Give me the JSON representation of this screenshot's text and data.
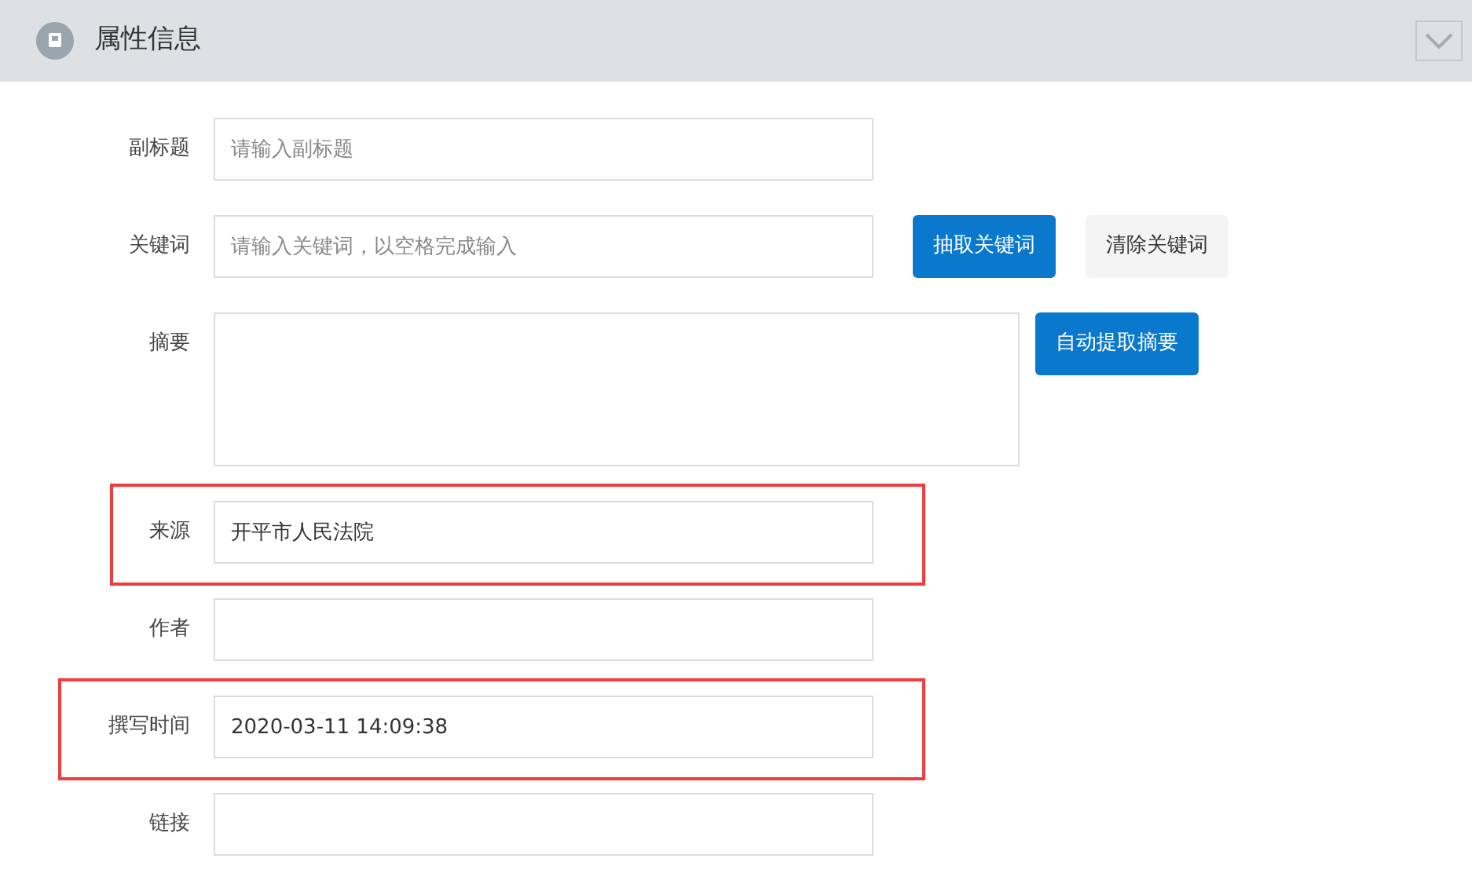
{
  "panel": {
    "title": "属性信息",
    "expanded": true
  },
  "fields": [
    {
      "label": "副标题",
      "kind": "input",
      "placeholder": "请输入副标题",
      "highlighted": false
    },
    {
      "label": "关键词",
      "kind": "input",
      "placeholder": "请输入关键词，以空格完成输入",
      "highlighted": false,
      "buttons": [
        {
          "label": "抽取关键词",
          "kind": "primary"
        },
        {
          "label": "清除关键词",
          "kind": "secondary"
        }
      ]
    },
    {
      "label": "摘要",
      "kind": "textarea",
      "highlighted": false,
      "buttons": [
        {
          "label": "自动提取摘要",
          "kind": "primary"
        }
      ]
    },
    {
      "label": "来源",
      "kind": "input",
      "value": "开平市人民法院",
      "highlighted": true
    },
    {
      "label": "作者",
      "kind": "input",
      "highlighted": false
    },
    {
      "label": "撰写时间",
      "kind": "input",
      "value": "2020-03-11 14:09:38",
      "highlighted": true
    },
    {
      "label": "链接",
      "kind": "input",
      "highlighted": false
    }
  ]
}
